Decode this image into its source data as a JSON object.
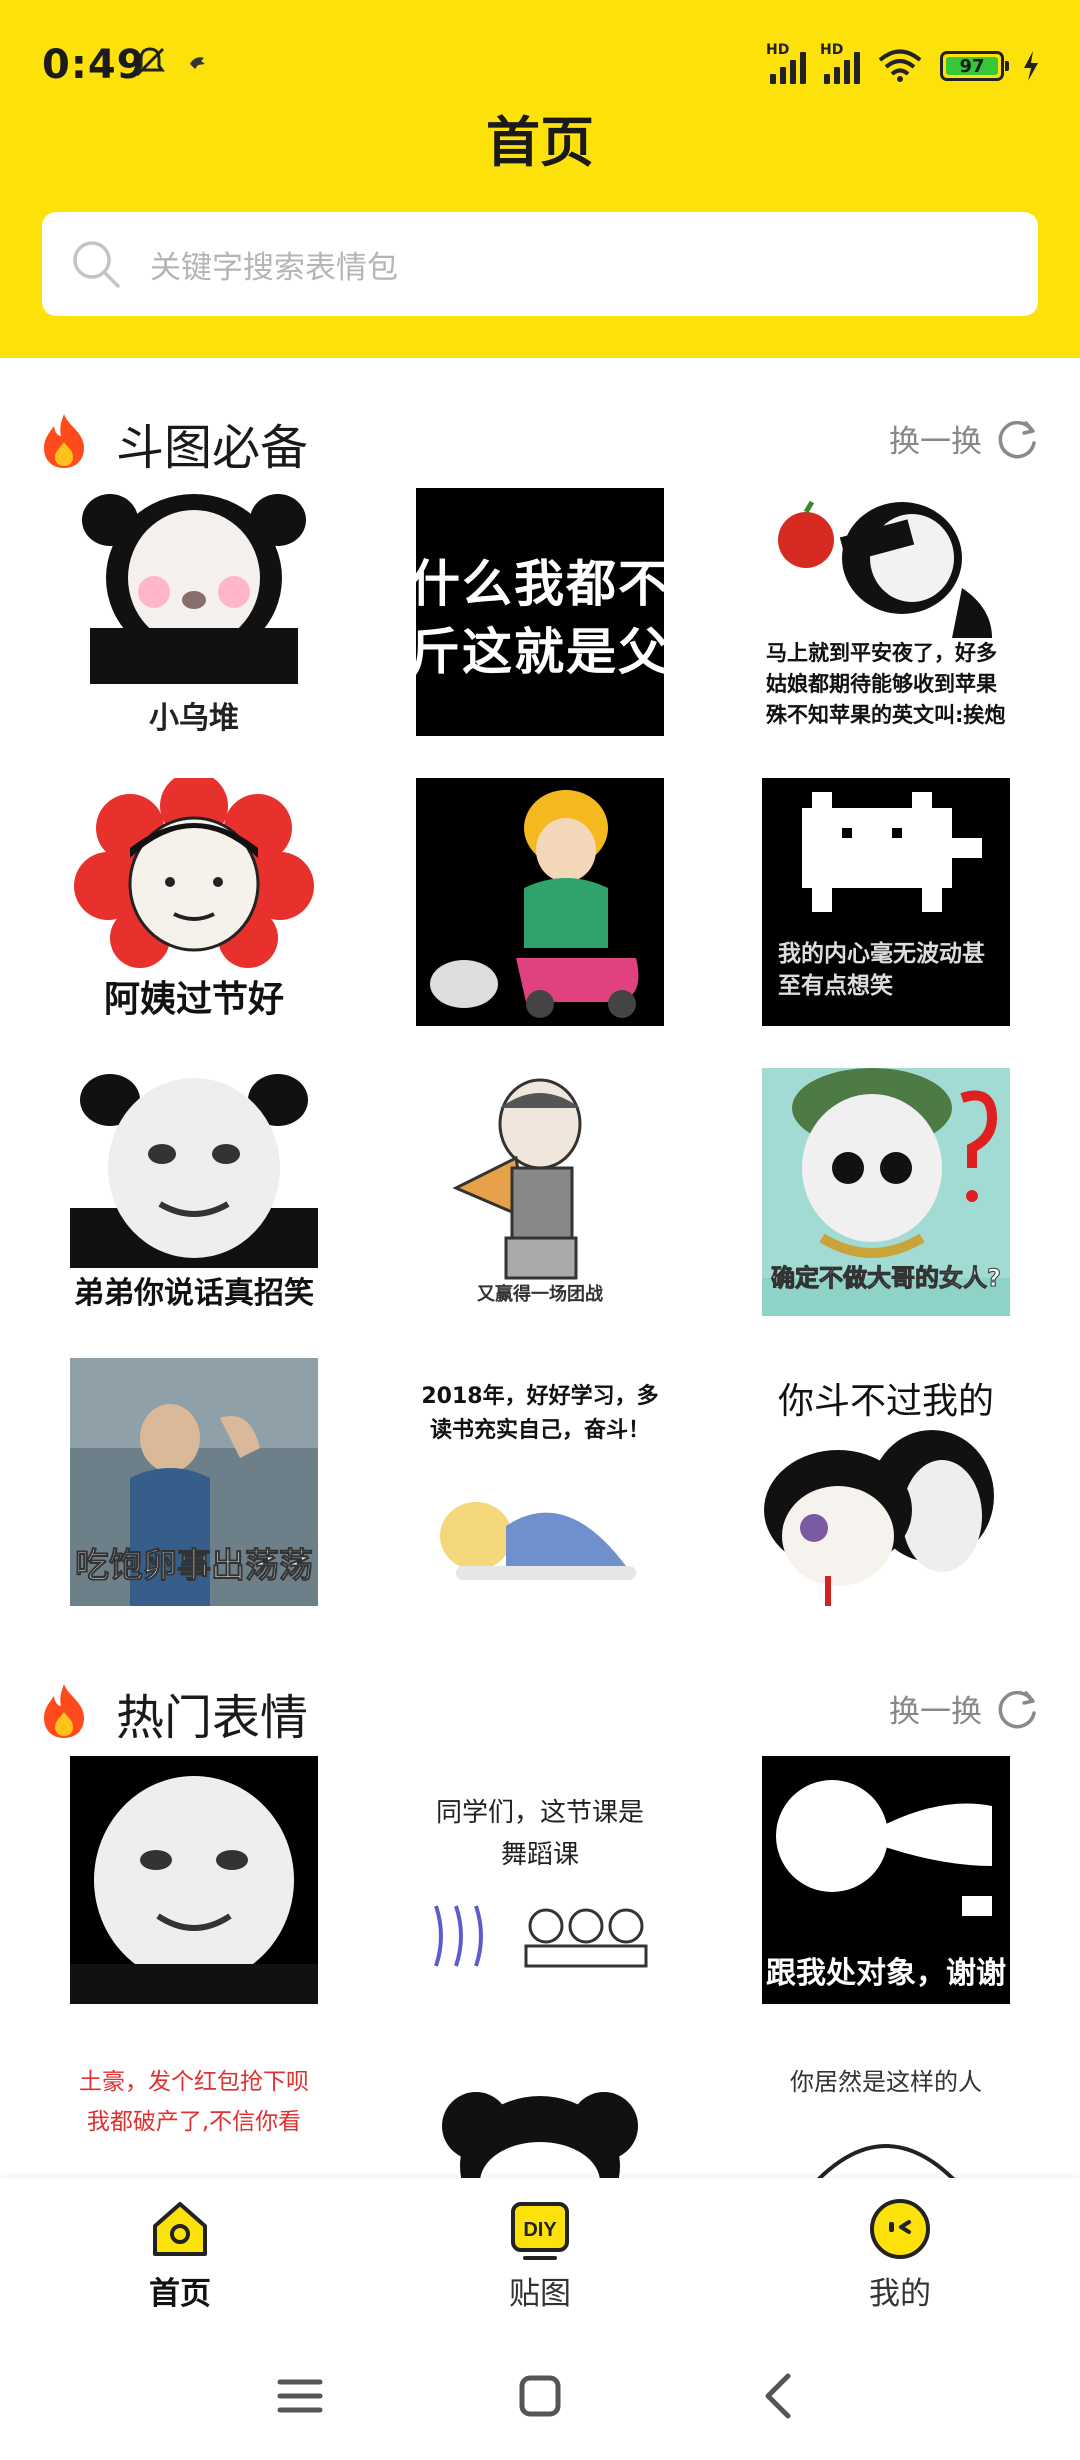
{
  "status_bar": {
    "time": "0:49",
    "signal1_label": "HD",
    "signal2_label": "HD",
    "battery": "97"
  },
  "header": {
    "title": "首页"
  },
  "search": {
    "placeholder": "关键字搜索表情包"
  },
  "sections": [
    {
      "title": "斗图必备",
      "refresh_label": "换一换",
      "items": [
        {
          "caption": "小乌堆"
        },
        {
          "caption": "什么我都不 斤这就是父"
        },
        {
          "caption": "马上就到平安夜了，好多姑娘都期待能够收到苹果殊不知苹果的英文叫:挨炮"
        },
        {
          "caption": "阿姨过节好"
        },
        {
          "caption": ""
        },
        {
          "caption": "我的内心毫无波动甚至有点想笑"
        },
        {
          "caption": "弟弟你说话真招笑"
        },
        {
          "caption": "又赢得一场团战"
        },
        {
          "caption": "确定不做大哥的女人?"
        },
        {
          "caption": "吃饱卵事出荡荡"
        },
        {
          "caption": "2018年，好好学习，多读书充实自己，奋斗！"
        },
        {
          "caption": "你斗不过我的"
        }
      ]
    },
    {
      "title": "热门表情",
      "refresh_label": "换一换",
      "items": [
        {
          "caption": ""
        },
        {
          "caption": "同学们，这节课是舞蹈课"
        },
        {
          "caption": "跟我处对象，谢谢"
        },
        {
          "caption": "土豪，发个红包抢下呗 我都破产了,不信你看"
        },
        {
          "caption": ""
        },
        {
          "caption": "你居然是这样的人"
        }
      ]
    }
  ],
  "bottom_nav": [
    {
      "label": "首页",
      "icon": "home-icon",
      "active": true
    },
    {
      "label": "贴图",
      "icon": "diy-icon",
      "active": false
    },
    {
      "label": "我的",
      "icon": "profile-face-icon",
      "active": false
    }
  ],
  "colors": {
    "brand": "#FCE20A",
    "fire": "#FF4A1C"
  }
}
